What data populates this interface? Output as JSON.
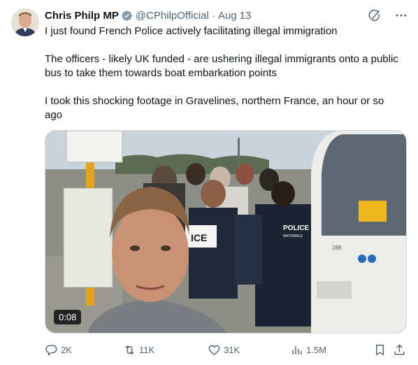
{
  "author": {
    "name": "Chris Philp MP",
    "handle": "@CPhilpOfficial",
    "separator": "·",
    "date": "Aug 13"
  },
  "tweet": {
    "paragraphs": [
      "I just found French Police actively facilitating illegal immigration",
      "The officers - likely UK funded - are ushering illegal immigrants onto a public bus to take them towards boat embarkation points",
      "I took this shocking footage in Gravelines, northern France, an hour or so ago"
    ]
  },
  "media": {
    "duration": "0:08",
    "overlay_texts": [
      "ICE",
      "POLICE",
      "NATIONALE",
      "288"
    ]
  },
  "actions": {
    "replies": "2K",
    "reposts": "11K",
    "likes": "31K",
    "views": "1.5M"
  },
  "icons": {
    "verified": "verified-badge-icon",
    "grok": "grok-icon",
    "more": "more-icon",
    "reply": "reply-icon",
    "repost": "repost-icon",
    "like": "heart-icon",
    "views": "views-icon",
    "bookmark": "bookmark-icon",
    "share": "share-icon"
  },
  "colors": {
    "text": "#0f1419",
    "secondary": "#536471",
    "verified": "#829aab",
    "border": "#cfd9de"
  }
}
